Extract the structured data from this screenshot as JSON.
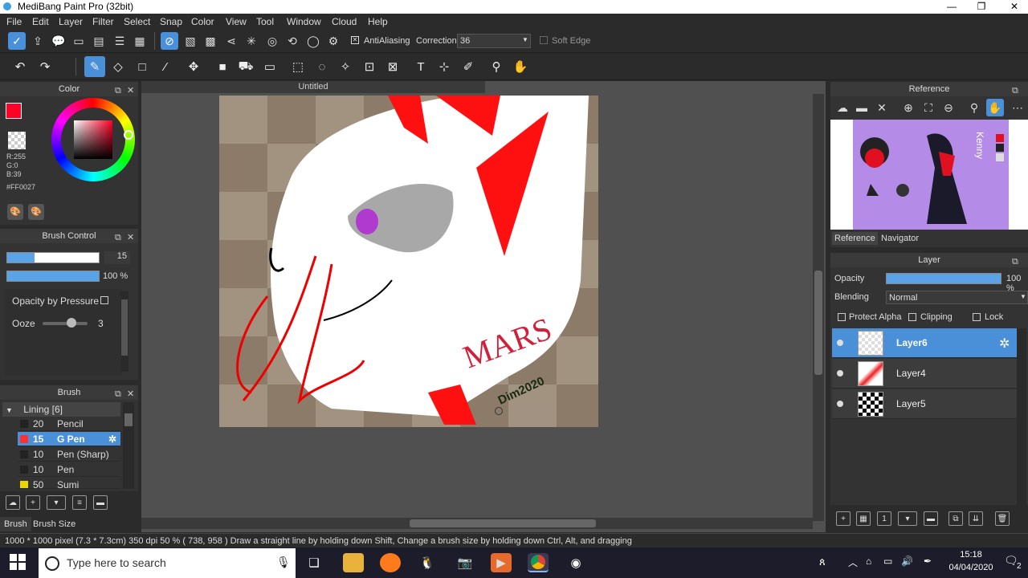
{
  "titlebar": {
    "title": "MediBang Paint Pro (32bit)",
    "minimize": "—",
    "maximize": "❐",
    "close": "✕"
  },
  "menu": [
    "File",
    "Edit",
    "Layer",
    "Filter",
    "Select",
    "Snap",
    "Color",
    "View",
    "Tool",
    "Window",
    "Cloud",
    "Help"
  ],
  "toolbar": {
    "antialiasing_label": "AntiAliasing",
    "correction_label": "Correction",
    "correction_value": "36",
    "soft_edge_label": "Soft Edge"
  },
  "color_panel": {
    "title": "Color",
    "r": "R:255",
    "g": "G:0",
    "b": "B:39",
    "hex": "#FF0027",
    "primary": "#FF0027"
  },
  "brush_control": {
    "title": "Brush Control",
    "size_value": "15",
    "opacity_value": "100 %",
    "size_fraction": 0.3,
    "opacity_fraction": 1.0,
    "opacity_by_pressure": "Opacity by Pressure",
    "ooze_label": "Ooze",
    "ooze_value": "3"
  },
  "brush_panel": {
    "title": "Brush",
    "group": "Lining [6]",
    "items": [
      {
        "size": "20",
        "name": "Pencil",
        "color": "#222222"
      },
      {
        "size": "15",
        "name": "G Pen",
        "color": "#ff3030"
      },
      {
        "size": "10",
        "name": "Pen (Sharp)",
        "color": "#222222"
      },
      {
        "size": "10",
        "name": "Pen",
        "color": "#222222"
      },
      {
        "size": "50",
        "name": "Sumi",
        "color": "#e8d800"
      }
    ],
    "tab_brush": "Brush",
    "tab_brush_size": "Brush Size"
  },
  "canvas": {
    "doc_title": "Untitled",
    "signature": "MARS",
    "tag": "Dim2020"
  },
  "reference_panel": {
    "title": "Reference",
    "tab_reference": "Reference",
    "tab_navigator": "Navigator",
    "ref_name": "Kenny"
  },
  "layer_panel": {
    "title": "Layer",
    "opacity_label": "Opacity",
    "opacity_value": "100 %",
    "blending_label": "Blending",
    "blending_value": "Normal",
    "protect_alpha": "Protect Alpha",
    "clipping": "Clipping",
    "lock": "Lock",
    "layers": [
      {
        "name": "Layer6"
      },
      {
        "name": "Layer4"
      },
      {
        "name": "Layer5"
      }
    ]
  },
  "statusbar": {
    "text": "1000 * 1000 pixel  (7.3 * 7.3cm)  350 dpi  50 %  ( 738, 958 )  Draw a straight line by holding down Shift, Change a brush size by holding down Ctrl, Alt, and dragging"
  },
  "taskbar": {
    "search_placeholder": "Type here to search",
    "time": "15:18",
    "date": "04/04/2020",
    "notification_count": "2"
  }
}
